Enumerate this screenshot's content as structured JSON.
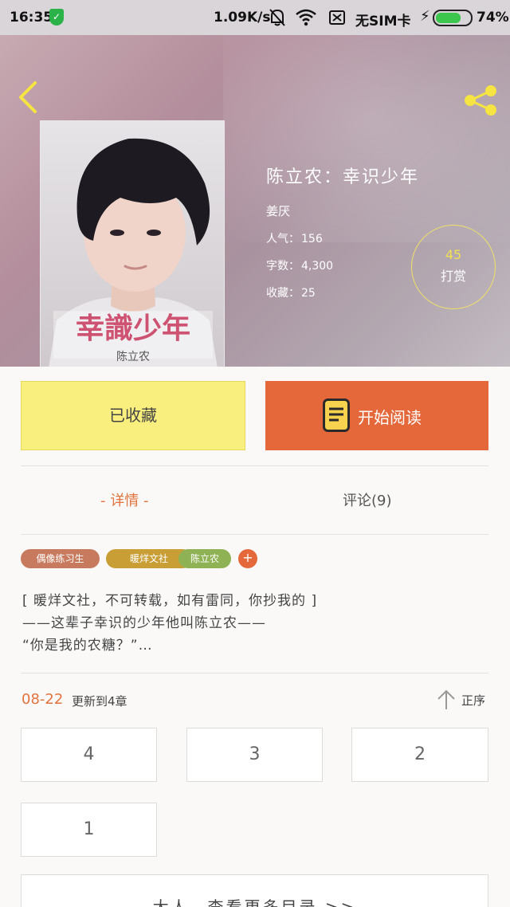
{
  "status_bar": {
    "time": "16:35",
    "network_speed": "1.09K/s",
    "carrier": "无SIM卡",
    "battery": "74%"
  },
  "book": {
    "title": "陈立农：幸识少年",
    "author": "姜厌",
    "stats": [
      {
        "label": "人气：",
        "value": "156"
      },
      {
        "label": "字数：",
        "value": "4,300"
      },
      {
        "label": "收藏：",
        "value": "25"
      }
    ],
    "cover_lettering": "幸識少年 陈立农"
  },
  "tip": {
    "count": "45",
    "label": "打赏"
  },
  "actions": {
    "favorite_label": "已收藏",
    "read_label": "开始阅读"
  },
  "tabs": [
    {
      "label": "- 详情 -",
      "active": true
    },
    {
      "label": "评论(9)",
      "active": false
    }
  ],
  "tags": [
    {
      "label": "偶像练习生",
      "color": "#c87a5e"
    },
    {
      "label": "暖烊文社",
      "color": "#c89e35"
    },
    {
      "label": "陈立农",
      "color": "#8fb354"
    }
  ],
  "tag_add_label": "+",
  "synopsis": [
    "[ 暖烊文社，不可转载，如有雷同，你抄我的 ]",
    "——这辈子幸识的少年他叫陈立农——",
    "“你是我的农糖？”…"
  ],
  "update": {
    "date": "08-22",
    "text": "更新到4章",
    "order_label": "正序"
  },
  "chapters": [
    "4",
    "3",
    "2",
    "1"
  ],
  "more_toc_label": "大人，查看更多目录 >>",
  "colors": {
    "accent": "#e5683a",
    "favorite_bg": "#f9ef7e",
    "tip_ring": "#f1e06a"
  }
}
